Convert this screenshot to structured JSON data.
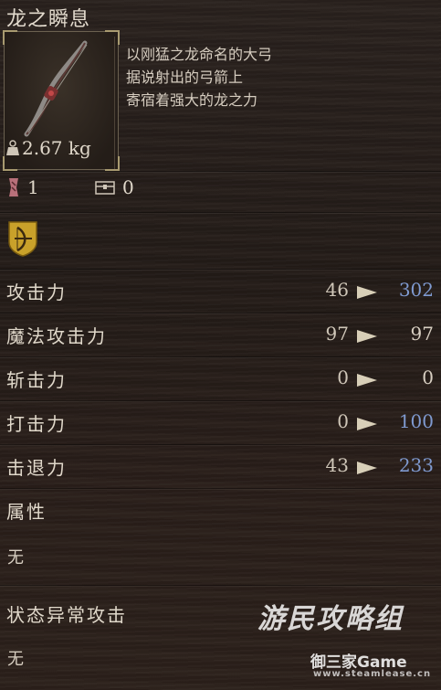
{
  "item": {
    "name": "龙之瞬息",
    "weight": "2.67 kg",
    "description": [
      "以刚猛之龙命名的大弓",
      "据说射出的弓箭上",
      "寄宿着强大的龙之力"
    ],
    "slot_count": "1",
    "storage_count": "0"
  },
  "stats": [
    {
      "label": "攻击力",
      "current": "46",
      "new": "302",
      "new_color": "#7f9ad0"
    },
    {
      "label": "魔法攻击力",
      "current": "97",
      "new": "97",
      "new_color": "#d8cfc2"
    },
    {
      "label": "斩击力",
      "current": "0",
      "new": "0",
      "new_color": "#d8cfc2"
    },
    {
      "label": "打击力",
      "current": "0",
      "new": "100",
      "new_color": "#7f9ad0"
    },
    {
      "label": "击退力",
      "current": "43",
      "new": "233",
      "new_color": "#7f9ad0"
    }
  ],
  "attribute": {
    "label": "属性",
    "value": "无"
  },
  "status_attack": {
    "label": "状态异常攻击",
    "value": "无"
  },
  "watermark": {
    "line1": "游民攻略组",
    "line2": "御三家Game",
    "line3": "www.steamlease.cn"
  }
}
